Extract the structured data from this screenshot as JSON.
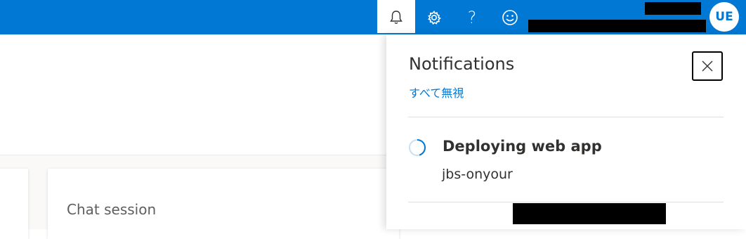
{
  "header": {
    "avatar_initials": "UE",
    "icons": [
      "bell-icon",
      "gear-icon",
      "help-icon",
      "smile-icon"
    ],
    "colors": {
      "bar": "#0078d4",
      "active_tab": "#ffffff"
    }
  },
  "main": {
    "card_title": "Chat session"
  },
  "notifications": {
    "title": "Notifications",
    "dismiss_all": "すべて無視",
    "items": [
      {
        "title": "Deploying web app",
        "subtitle": "jbs-onyour",
        "status": "in-progress"
      }
    ]
  }
}
